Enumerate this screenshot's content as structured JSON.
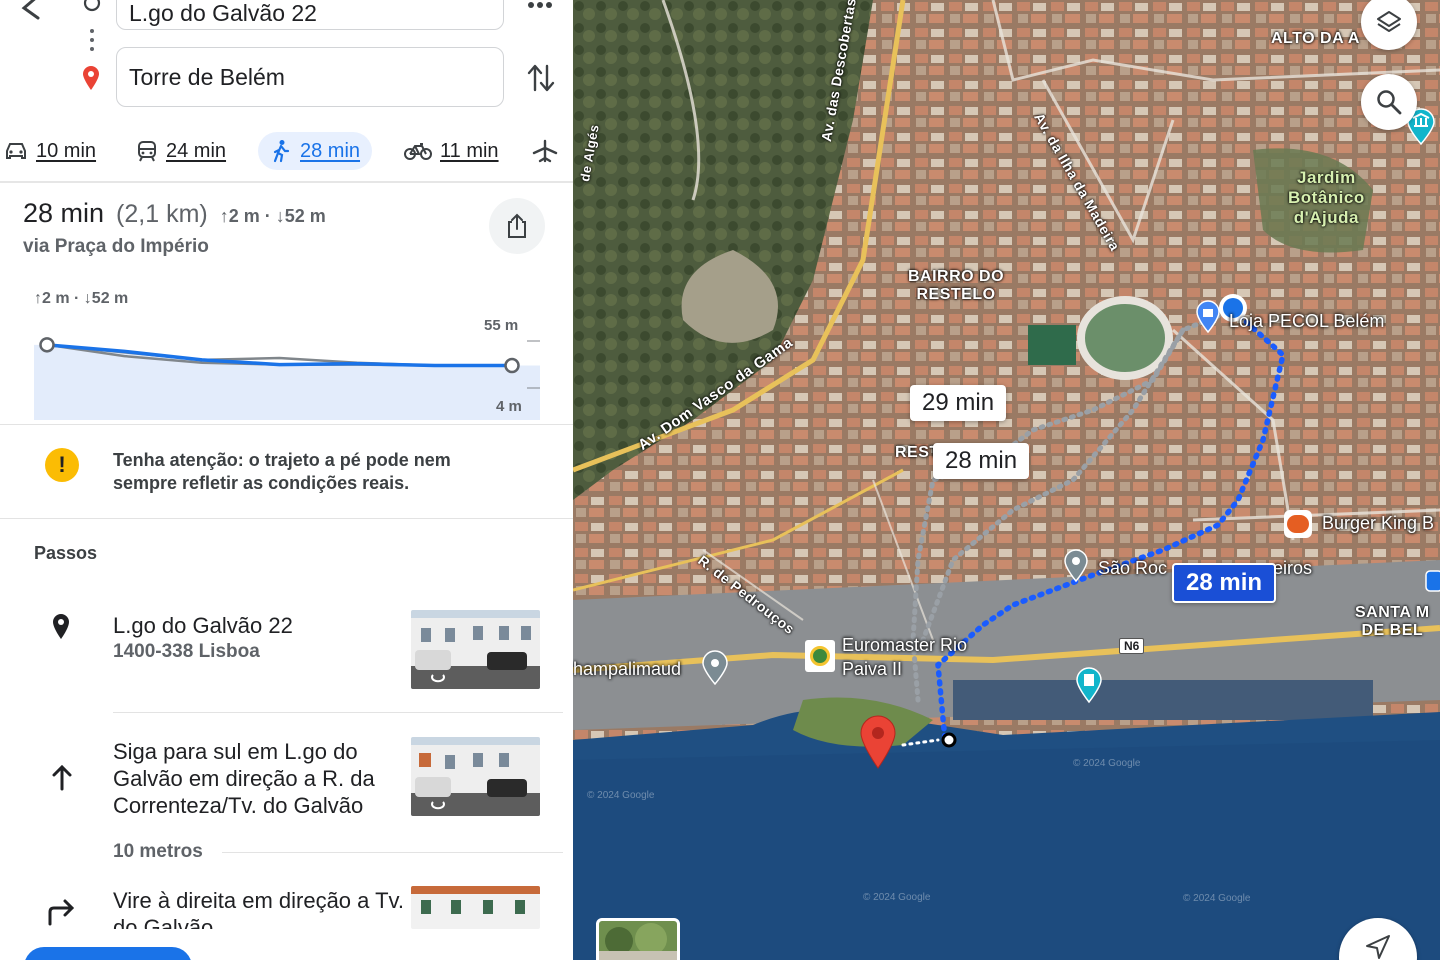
{
  "route": {
    "origin": "L.go do Galvão 22",
    "destination": "Torre de Belém",
    "more_icon": "more-vert-icon",
    "swap_icon": "swap-vertical-icon"
  },
  "modes": [
    {
      "icon": "car-icon",
      "label": "10 min"
    },
    {
      "icon": "transit-icon",
      "label": "24 min"
    },
    {
      "icon": "walk-icon",
      "label": "28 min",
      "active": true
    },
    {
      "icon": "bike-icon",
      "label": "11 min"
    },
    {
      "icon": "flight-icon",
      "label": ""
    }
  ],
  "summary": {
    "duration": "28 min",
    "distance": "(2,1 km)",
    "elevation": "↑2 m · ↓52 m",
    "via": "via Praça do Império"
  },
  "elevation_chart": {
    "label": "↑2 m · ↓52 m",
    "top_label": "55 m",
    "bottom_label": "4 m"
  },
  "chart_data": {
    "type": "area",
    "title": "",
    "ylim": [
      4,
      55
    ],
    "series": [
      {
        "values": [
          52,
          40,
          33,
          31,
          31,
          30,
          30
        ]
      },
      {
        "values": [
          52,
          44,
          36,
          38,
          33,
          30,
          30
        ]
      },
      {
        "values": [
          52,
          45,
          36,
          31,
          32,
          30,
          30
        ]
      }
    ]
  },
  "warning": {
    "text": "Tenha atenção: o trajeto a pé pode nem sempre refletir as condições reais."
  },
  "steps": {
    "heading": "Passos",
    "items": [
      {
        "icon": "place-pin-icon",
        "title": "L.go do Galvão 22",
        "subtitle": "1400-338 Lisboa"
      },
      {
        "icon": "arrow-up-icon",
        "title": "Siga para sul em L.go do Galvão em direção a R. da Correnteza/Tv. do Galvão",
        "distance": "10 metros"
      },
      {
        "icon": "turn-right-icon",
        "title": "Vire à direita em direção a Tv. do Galvão"
      }
    ]
  },
  "map": {
    "labels": {
      "alto": "ALTO DA A",
      "jardim": "Jardim\nBotânico\nd'Ajuda",
      "bairro": "BAIRRO DO\nRESTELO",
      "rest": "REST",
      "santa": "SANTA M\nDE BEL",
      "ave_descobertas": "Av. das Descobertas",
      "ave_ilha": "Av. da Ilha da Madeira",
      "ave_gama": "Av. Dom Vasco da Gama",
      "rua_pedroucos": "R. de Pedrouços",
      "road_n6": "N6",
      "algés": "de Algés"
    },
    "pois": {
      "loja": "Loja PECOL Belém",
      "burger": "Burger King B",
      "sao_roque": "São Roc",
      "eiros": "eiros",
      "euromaster": "Euromaster Rio\nPaiva II",
      "champalimaud": "hampalimaud"
    },
    "bubbles": {
      "alt1": "29 min",
      "alt2": "28 min",
      "main": "28 min"
    },
    "watermark": "© 2024 Google",
    "accent": "#1a73e8"
  }
}
